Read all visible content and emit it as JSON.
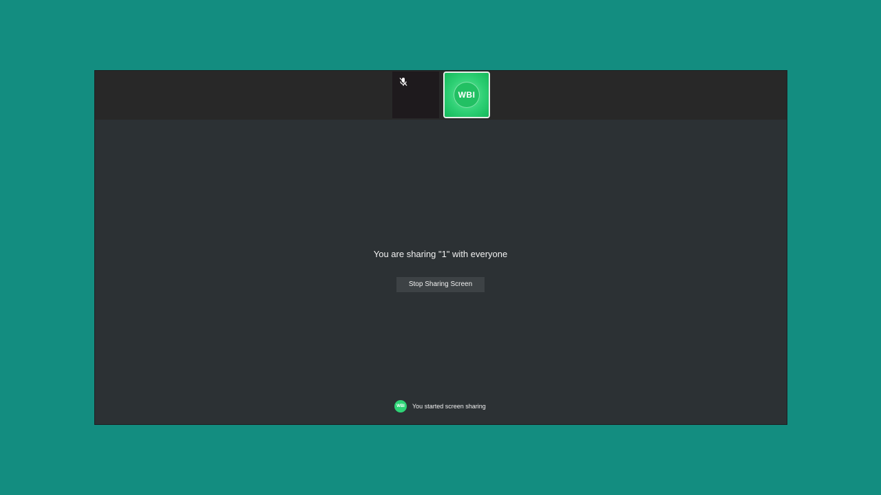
{
  "participants": {
    "muted_tile": {
      "icon": "mic-off-icon"
    },
    "active_tile": {
      "avatar_text": "WBI",
      "accent_color": "#2fd075"
    }
  },
  "main": {
    "share_message": "You are sharing \"1\" with everyone",
    "stop_button_label": "Stop Sharing Screen"
  },
  "notification": {
    "avatar_text": "WBI",
    "text": "You started screen sharing"
  },
  "colors": {
    "background": "#138d80",
    "window": "#2c3134",
    "top_strip": "#282828"
  }
}
